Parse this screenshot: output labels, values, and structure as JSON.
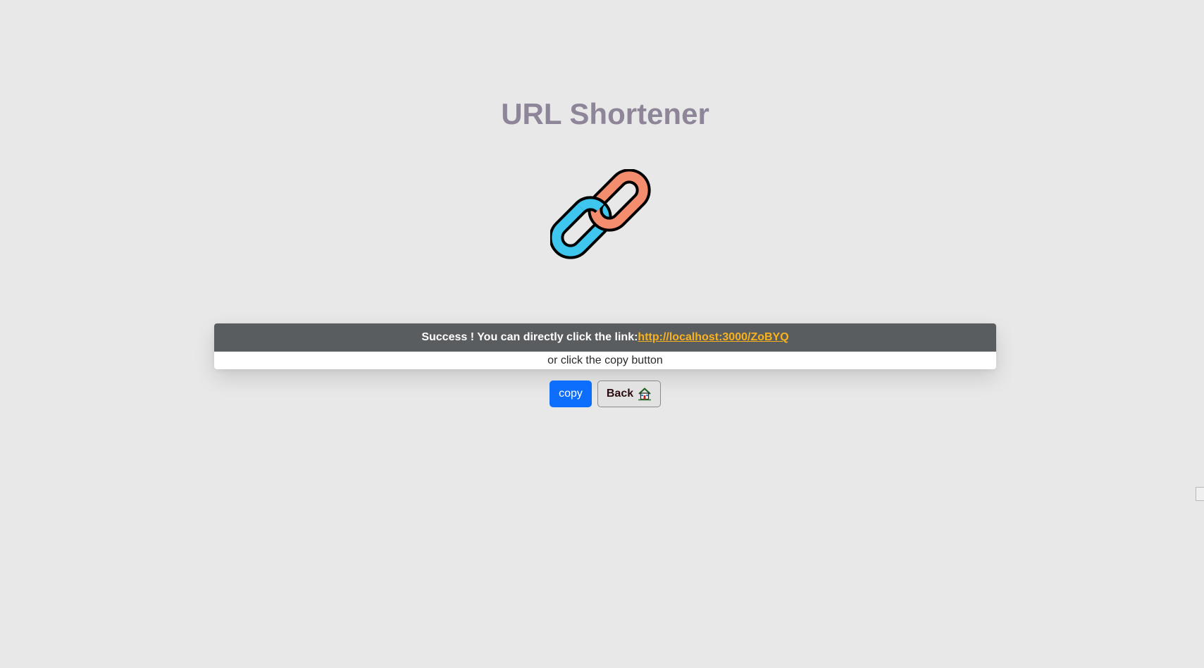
{
  "page": {
    "title": "URL Shortener"
  },
  "result": {
    "success_text": "Success ! You can directly click the link:",
    "short_url": "http://localhost:3000/ZoBYQ",
    "hint_text": "or click the copy button"
  },
  "actions": {
    "copy_label": "copy",
    "back_label": "Back"
  },
  "icons": {
    "logo": "chain-link-icon",
    "back": "home-icon"
  },
  "colors": {
    "background": "#e8e8e8",
    "title": "#8e8698",
    "header_bar": "#5a5d60",
    "link": "#f9b21b",
    "copy_button": "#0d6efd",
    "chain_blue": "#3fc6ee",
    "chain_orange": "#f48c6e"
  }
}
